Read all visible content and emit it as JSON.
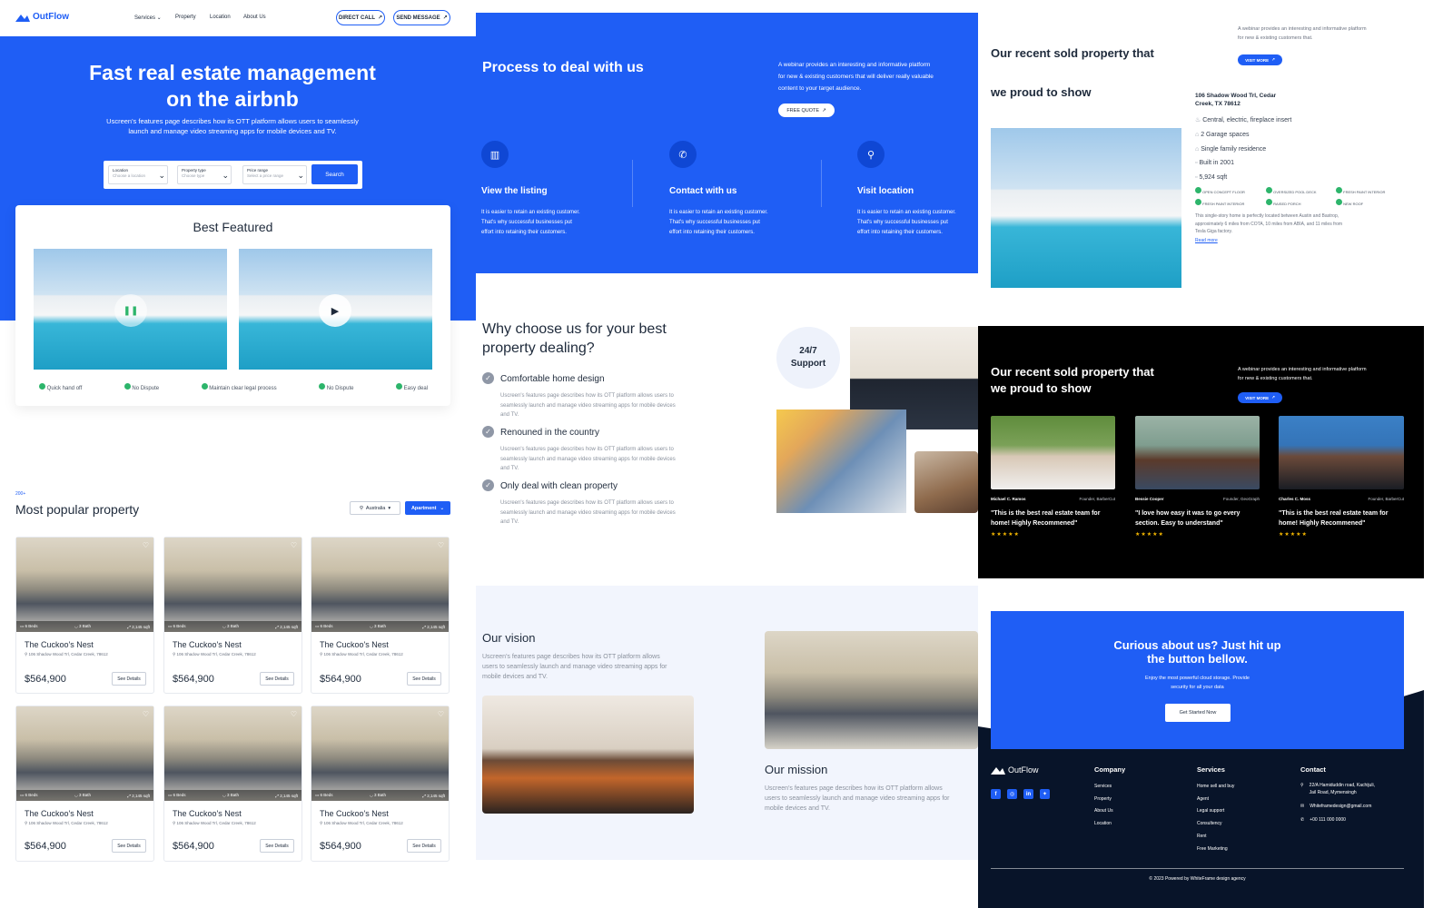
{
  "colors": {
    "accent": "#1f5ef5",
    "dark": "#000000",
    "footer": "#081429",
    "success": "#2db56b"
  },
  "nav": {
    "brand": "OutFlow",
    "links": [
      "Services",
      "Property",
      "Location",
      "About Us"
    ],
    "direct_call": "DIRECT CALL",
    "send_message": "SEND MESSAGE"
  },
  "hero": {
    "title1": "Fast real estate management",
    "title2": "on the airbnb",
    "subtitle1": "Uscreen's features page describes how its OTT platform allows users to seamlessly",
    "subtitle2": "launch and manage video streaming apps for mobile devices and TV.",
    "search": {
      "location_label": "Location",
      "location_value": "Choose a location",
      "type_label": "Property type",
      "type_value": "Choose type",
      "price_label": "Price range",
      "price_value": "Select a price range",
      "button": "Search"
    }
  },
  "featured": {
    "title": "Best Featured",
    "features": [
      "Quick hand off",
      "No Dispute",
      "Maintain clear legal process",
      "No Dispute",
      "Easy deal"
    ]
  },
  "popular": {
    "eyebrow": "200+",
    "title": "Most popular property",
    "filter_country": "Australia",
    "filter_type": "Apartment",
    "cards": [
      {
        "name": "The Cuckoo's Nest",
        "address": "106 Shadow Wood Trl, Cedar Creek, 78612",
        "price": "$564,900",
        "beds": "6 Beds",
        "bath": "3 Bath",
        "sqft": "2,145 sqft",
        "details": "See Details"
      },
      {
        "name": "The Cuckoo's Nest",
        "address": "106 Shadow Wood Trl, Cedar Creek, 78612",
        "price": "$564,900",
        "beds": "6 Beds",
        "bath": "3 Bath",
        "sqft": "2,145 sqft",
        "details": "See Details"
      },
      {
        "name": "The Cuckoo's Nest",
        "address": "106 Shadow Wood Trl, Cedar Creek, 78612",
        "price": "$564,900",
        "beds": "6 Beds",
        "bath": "3 Bath",
        "sqft": "2,145 sqft",
        "details": "See Details"
      },
      {
        "name": "The Cuckoo's Nest",
        "address": "106 Shadow Wood Trl, Cedar Creek, 78612",
        "price": "$564,900",
        "beds": "6 Beds",
        "bath": "3 Bath",
        "sqft": "2,145 sqft",
        "details": "See Details"
      },
      {
        "name": "The Cuckoo's Nest",
        "address": "106 Shadow Wood Trl, Cedar Creek, 78612",
        "price": "$564,900",
        "beds": "6 Beds",
        "bath": "3 Bath",
        "sqft": "2,145 sqft",
        "details": "See Details"
      },
      {
        "name": "The Cuckoo's Nest",
        "address": "106 Shadow Wood Trl, Cedar Creek, 78612",
        "price": "$564,900",
        "beds": "6 Beds",
        "bath": "3 Bath",
        "sqft": "2,145 sqft",
        "details": "See Details"
      }
    ]
  },
  "process": {
    "title": "Process to deal with us",
    "desc1": "A webinar provides an interesting and informative platform",
    "desc2": "for new & existing customers that will deliver really valuable",
    "desc3": "content to your target audience.",
    "quote": "FREE QUOTE",
    "steps": [
      {
        "icon": "building-icon",
        "title": "View the listing",
        "l1": "It is easier to retain an existing customer.",
        "l2": "That's why successful businesses put",
        "l3": "effort into retaining their customers."
      },
      {
        "icon": "phone-icon",
        "title": "Contact with us",
        "l1": "It is easier to retain an existing customer.",
        "l2": "That's why successful businesses put",
        "l3": "effort into retaining their customers."
      },
      {
        "icon": "location-pin-icon",
        "title": "Visit location",
        "l1": "It is easier to retain an existing customer.",
        "l2": "That's why successful businesses put",
        "l3": "effort into retaining their customers."
      }
    ]
  },
  "why": {
    "title1": "Why choose us for your best",
    "title2": "property dealing?",
    "support1": "24/7",
    "support2": "Support",
    "items": [
      {
        "title": "Comfortable home design",
        "l1": "Uscreen's features page describes how its OTT platform allows users to",
        "l2": "seamlessly launch and manage video streaming apps for mobile devices",
        "l3": "and TV."
      },
      {
        "title": "Renouned in the country",
        "l1": "Uscreen's features page describes how its OTT platform allows users to",
        "l2": "seamlessly launch and manage video streaming apps for mobile devices",
        "l3": "and TV."
      },
      {
        "title": "Only deal with clean property",
        "l1": "Uscreen's features page describes how its OTT platform allows users to",
        "l2": "seamlessly launch and manage video streaming apps for mobile devices",
        "l3": "and TV."
      }
    ]
  },
  "vision": {
    "vision_title": "Our vision",
    "vision_l1": "Uscreen's features page describes how its OTT platform allows",
    "vision_l2": "users to seamlessly launch and manage video streaming apps for",
    "vision_l3": "mobile devices and TV.",
    "mission_title": "Our mission",
    "mission_l1": "Uscreen's features page describes how its OTT platform allows",
    "mission_l2": "users to seamlessly launch and manage video streaming apps for",
    "mission_l3": "mobile devices and TV."
  },
  "sold": {
    "title1": "Our recent sold property that",
    "title2": "we proud to show",
    "desc1": "A webinar provides an interesting and informative platform",
    "desc2": "for new & existing customers that.",
    "visit": "VISIT MORE",
    "address1": "106 Shadow Wood Trl, Cedar",
    "address2": "Creek, TX 78612",
    "specs": [
      "Central, electric, fireplace insert",
      "2 Garage spaces",
      "Single family residence",
      "Built in 2001",
      "5,924 sqft"
    ],
    "tags": [
      "OPEN CONCEPT FLOOR",
      "OVERSIZED POOL DECK",
      "FRESH PAINT INTERIOR",
      "FRESH PAINT INTERIOR",
      "RAISED PORCH",
      "NEW ROOF"
    ],
    "note1": "This single-story home is perfectly located between Austin and Bastrop,",
    "note2": "approximately 6 miles from COTA, 10 miles from ABIA, and 11 miles from",
    "note3": "Tesla Giga factory.",
    "read_more": "Read more"
  },
  "testimonials": {
    "title1": "Our recent sold property that",
    "title2": "we proud to show",
    "desc1": "A webinar provides an interesting and informative platform",
    "desc2": "for new & existing customers that.",
    "visit": "VISIT MORE",
    "people": [
      {
        "name": "Michael C. Ramos",
        "role": "Founder, BarberCut",
        "q1": "\"This is the best real estate team for",
        "q2": "home! Highly Recommened\"",
        "stars": "★★★★★"
      },
      {
        "name": "Bessie Cooper",
        "role": "Founder, GeoGraph",
        "q1": "\"I love how easy it was to go every",
        "q2": "section. Easy to understand\"",
        "stars": "★★★★★"
      },
      {
        "name": "Charles C. Moss",
        "role": "Founder, BarberCut",
        "q1": "\"This is the best real estate team for",
        "q2": "home! Highly Recommened\"",
        "stars": "★★★★★"
      }
    ]
  },
  "cta": {
    "title1": "Curious about us? Just hit up",
    "title2": "the button bellow.",
    "sub1": "Enjoy the most powerful cloud storage. Provide",
    "sub2": "security for all your data",
    "button": "Get Started Now"
  },
  "footer": {
    "brand": "OutFlow",
    "company_title": "Company",
    "company": [
      "Services",
      "Property",
      "About Us",
      "Location"
    ],
    "services_title": "Services",
    "services": [
      "Home sell and buy",
      "Agent",
      "Legal support",
      "Consultency",
      "Rent",
      "Free Marketing"
    ],
    "contact_title": "Contact",
    "address1": "22/A Hamiduddin road, Kachijuli,",
    "address2": "Jail Road, Mymensingh",
    "email": "Whiteframedesign@gmail.com",
    "phone": "+00 111 000 0000",
    "copyright": "© 2023 Powered by WhiteFrame design agency"
  }
}
